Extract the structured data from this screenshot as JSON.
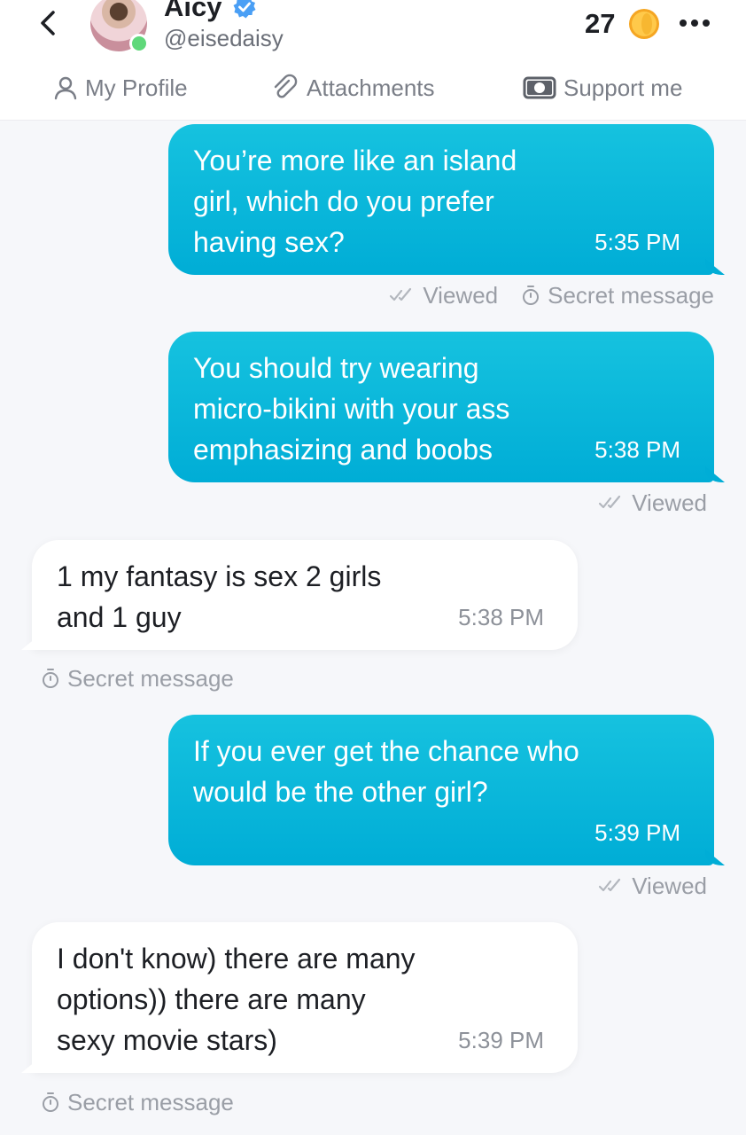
{
  "header": {
    "name": "Aicy",
    "handle": "@eisedaisy",
    "coins": "27",
    "verified": true,
    "online": true
  },
  "nav": {
    "tabs": [
      {
        "label": "My Profile",
        "icon": "person-icon"
      },
      {
        "label": "Attachments",
        "icon": "paperclip-icon"
      },
      {
        "label": "Support me",
        "icon": "banknote-icon"
      }
    ]
  },
  "messages": [
    {
      "direction": "outgoing",
      "text": "You’re more like an island girl, which do you prefer having sex?",
      "time": "5:35 PM",
      "status": "Viewed",
      "secret": "Secret message"
    },
    {
      "direction": "outgoing",
      "text": "You should try wearing micro-bikini with your ass emphasizing and boobs",
      "time": "5:38 PM",
      "status": "Viewed"
    },
    {
      "direction": "incoming",
      "text": "1 my fantasy is sex 2 girls and 1 guy",
      "time": "5:38 PM",
      "secret": "Secret message"
    },
    {
      "direction": "outgoing",
      "text": "If you ever get the chance who would be the other girl?",
      "time": "5:39 PM",
      "status": "Viewed"
    },
    {
      "direction": "incoming",
      "text": "I don't know) there are many options)) there are many sexy movie stars)",
      "time": "5:39 PM",
      "secret": "Secret message"
    }
  ],
  "colors": {
    "outgoing_bubble": "#00add6",
    "incoming_bubble": "#ffffff",
    "online": "#5fd87a",
    "verified": "#4a9ff5",
    "coin": "#f7b731"
  }
}
